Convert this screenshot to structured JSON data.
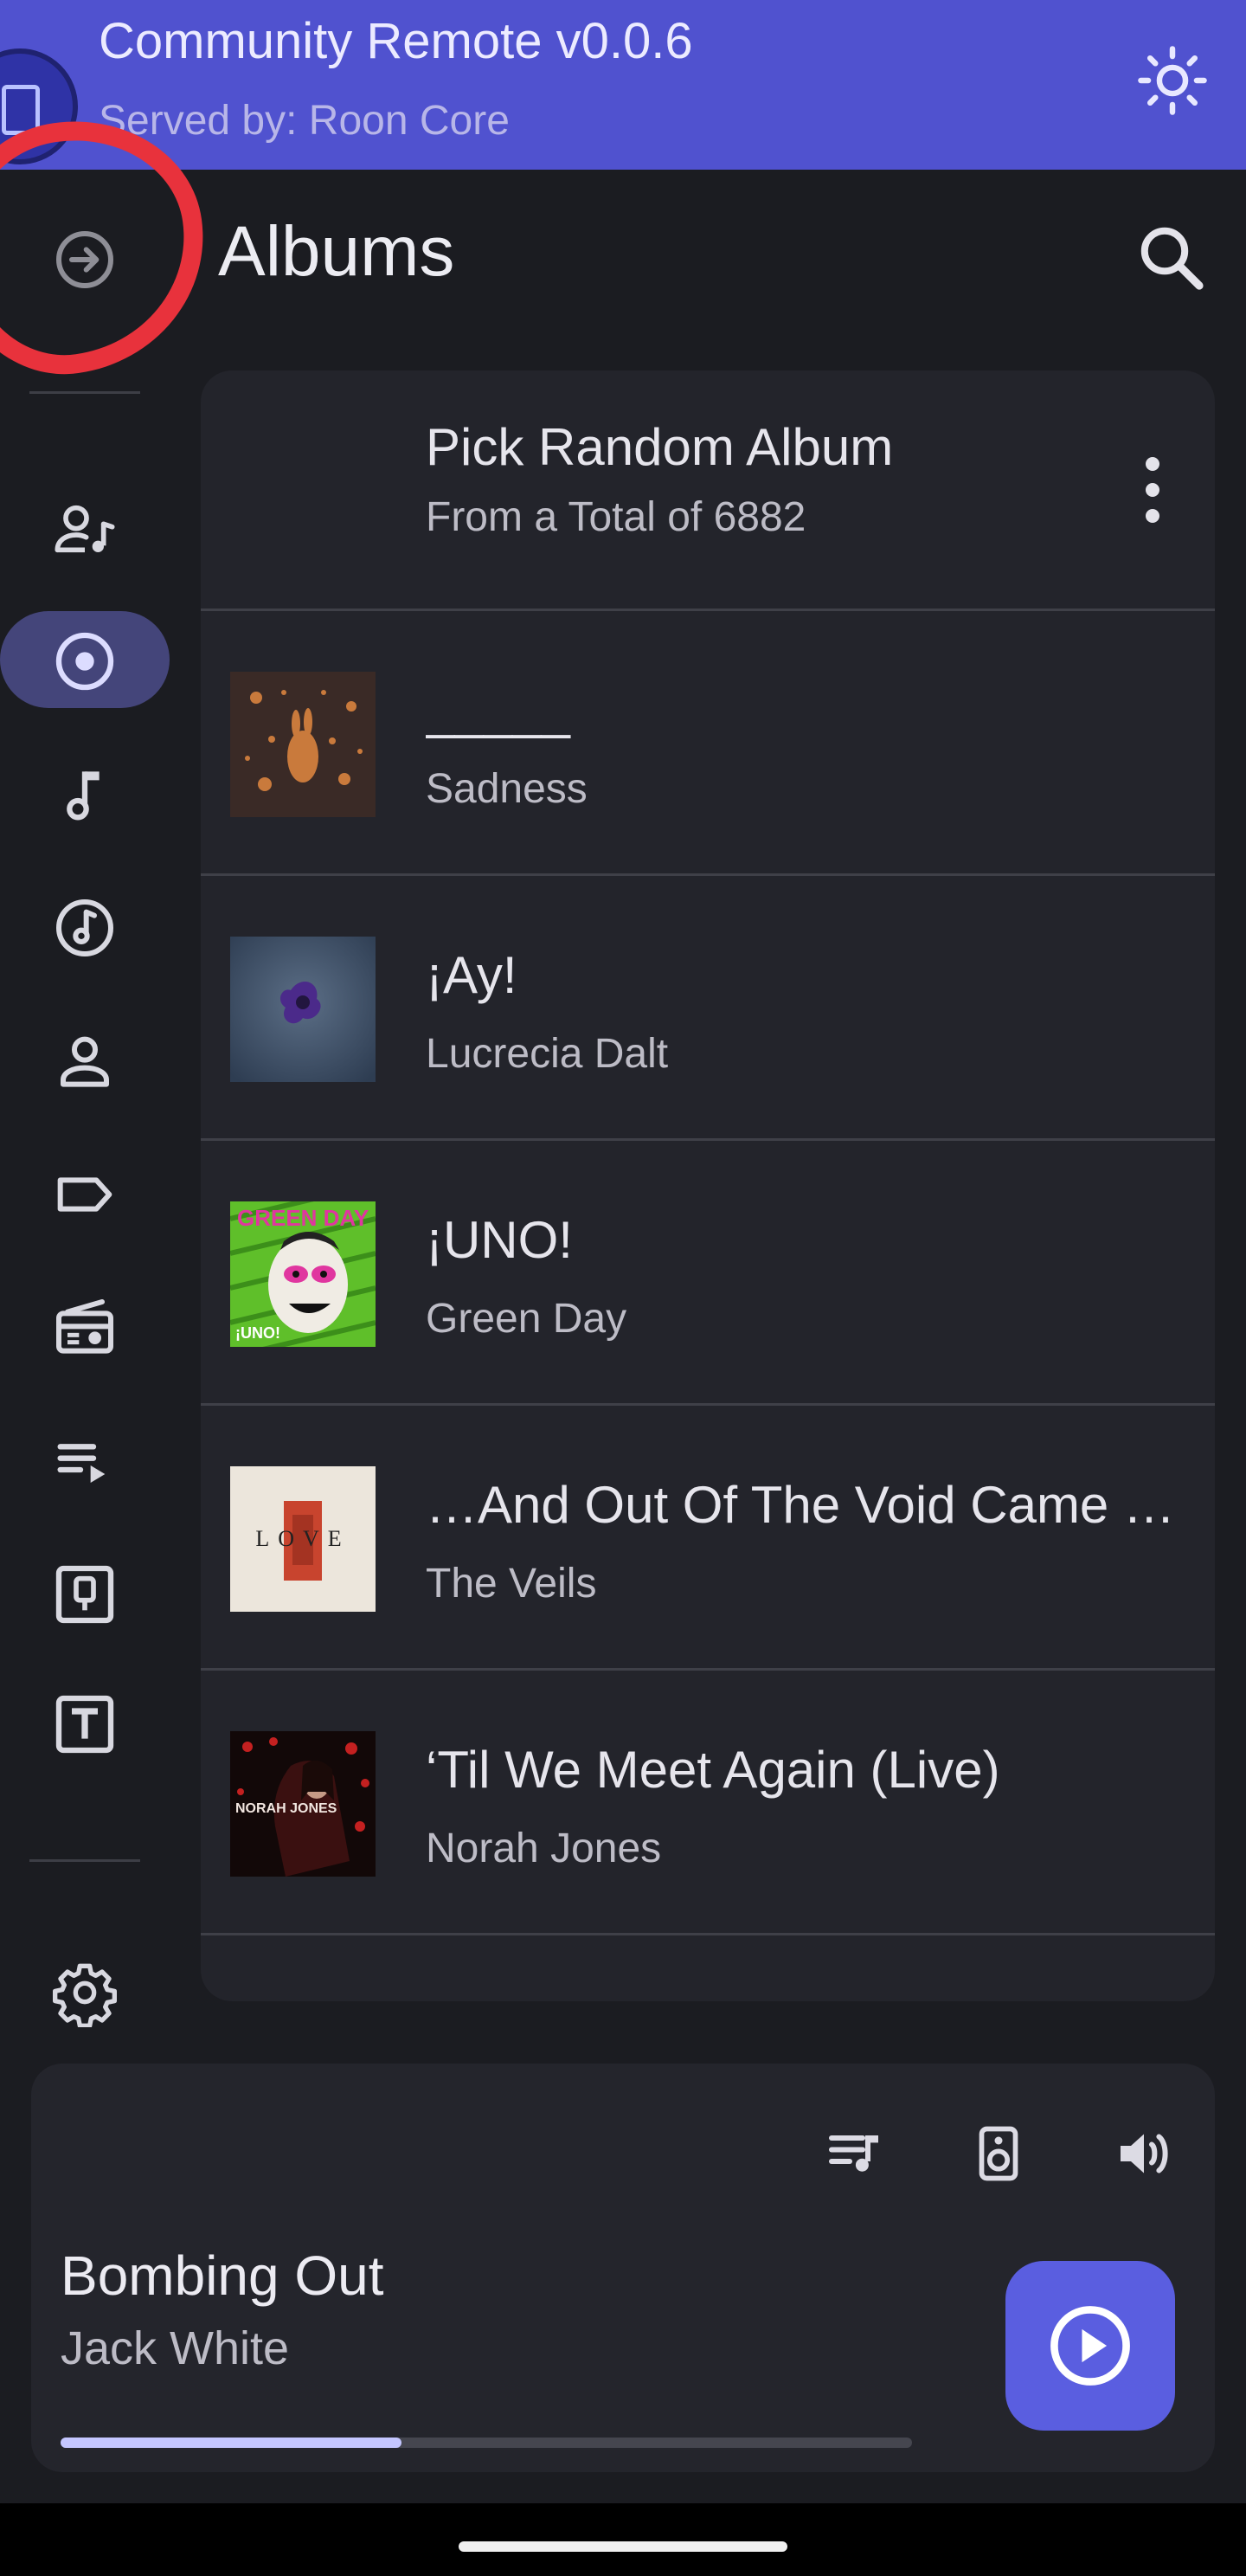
{
  "app": {
    "title": "Community Remote v0.0.6",
    "served_by": "Served by: Roon Core"
  },
  "header": {
    "title": "Albums"
  },
  "nav_rail": {
    "items": [
      {
        "icon": "expand-rail-icon",
        "label": "Expand navigation"
      },
      {
        "icon": "artist-music-icon",
        "label": "Artists"
      },
      {
        "icon": "album-disc-icon",
        "label": "Albums",
        "active": true
      },
      {
        "icon": "music-note-icon",
        "label": "Tracks"
      },
      {
        "icon": "composition-icon",
        "label": "Composers"
      },
      {
        "icon": "person-icon",
        "label": "Profile"
      },
      {
        "icon": "tag-icon",
        "label": "Tags"
      },
      {
        "icon": "radio-icon",
        "label": "Radio"
      },
      {
        "icon": "playlist-icon",
        "label": "Playlists"
      },
      {
        "icon": "qobuz-icon",
        "label": "Qobuz"
      },
      {
        "icon": "tidal-icon",
        "label": "Tidal"
      },
      {
        "icon": "gear-icon",
        "label": "Settings"
      }
    ]
  },
  "random_album": {
    "title": "Pick Random Album",
    "subtitle": "From a Total of 6882"
  },
  "albums": [
    {
      "title": "_____",
      "artist": "Sadness"
    },
    {
      "title": "¡Ay!",
      "artist": "Lucrecia Dalt"
    },
    {
      "title": "¡UNO!",
      "artist": "Green Day",
      "cover_text": "GREEN DAY",
      "cover_sub": "¡UNO!"
    },
    {
      "title": "…And Out Of The Void Came Love",
      "artist": "The Veils",
      "cover_text": "LOVE"
    },
    {
      "title": "‘Til We Meet Again (Live)",
      "artist": "Norah Jones",
      "cover_text": "NORAH JONES"
    }
  ],
  "now_playing": {
    "title": "Bombing Out",
    "artist": "Jack White",
    "progress": 0.4
  },
  "colors": {
    "accent": "#5052cf",
    "fab": "#5a5ee0",
    "progress": "#c4c6ff",
    "annotation": "#e8323c"
  }
}
